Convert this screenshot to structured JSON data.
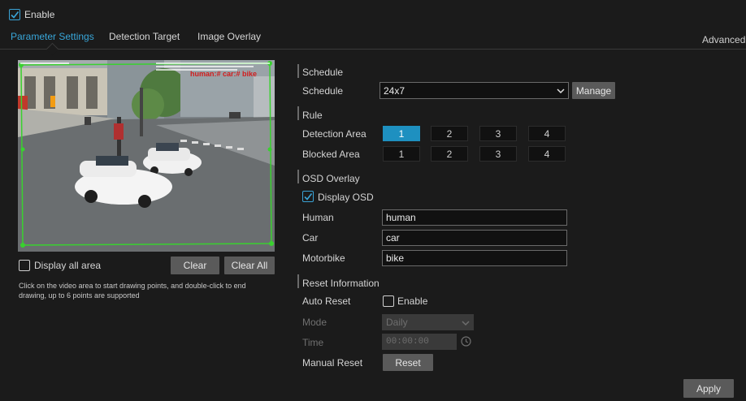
{
  "top": {
    "enable_label": "Enable",
    "enable_checked": true
  },
  "tabs": [
    {
      "label": "Parameter Settings",
      "active": true
    },
    {
      "label": "Detection Target",
      "active": false
    },
    {
      "label": "Image Overlay",
      "active": false
    }
  ],
  "advanced_label": "Advanced",
  "video": {
    "osd_text": "human:# car:# bike",
    "date_text": "",
    "corner_label": ""
  },
  "left": {
    "display_all_area_label": "Display all area",
    "display_all_area_checked": false,
    "clear_label": "Clear",
    "clear_all_label": "Clear All",
    "hint_line1": "Click on the video area to start drawing points, and double-click to end",
    "hint_line2": "drawing, up to 6 points are supported"
  },
  "schedule": {
    "section_title": "Schedule",
    "label": "Schedule",
    "value": "24x7",
    "manage_label": "Manage"
  },
  "rule": {
    "section_title": "Rule",
    "detection_area_label": "Detection Area",
    "blocked_area_label": "Blocked Area",
    "detection_areas": [
      "1",
      "2",
      "3",
      "4"
    ],
    "blocked_areas": [
      "1",
      "2",
      "3",
      "4"
    ],
    "selected_detection_area": "1"
  },
  "osd": {
    "section_title": "OSD Overlay",
    "display_osd_label": "Display OSD",
    "display_osd_checked": true,
    "human_label": "Human",
    "human_value": "human",
    "car_label": "Car",
    "car_value": "car",
    "motorbike_label": "Motorbike",
    "motorbike_value": "bike"
  },
  "reset": {
    "section_title": "Reset Information",
    "auto_reset_label": "Auto Reset",
    "enable_label": "Enable",
    "enable_checked": false,
    "mode_label": "Mode",
    "mode_value": "Daily",
    "time_label": "Time",
    "time_value": "00:00:00",
    "manual_reset_label": "Manual Reset",
    "reset_button_label": "Reset"
  },
  "apply_label": "Apply",
  "colors": {
    "accent": "#38a6d9",
    "selected": "#1e90c0",
    "detection_box": "#39d12f"
  }
}
